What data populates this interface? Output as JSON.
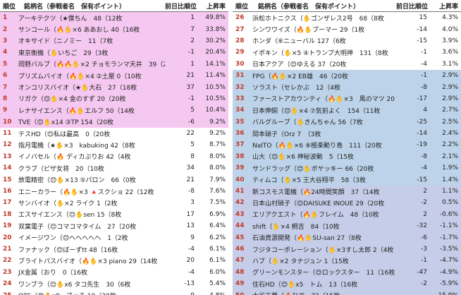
{
  "columns": {
    "rank": "順位",
    "name": "銘柄名（参戦者名　保有ポイント）",
    "diff": "前日比順位",
    "rate": "上昇率"
  },
  "colors": {
    "top_band": "#f4c8f0",
    "upper_right_band": "#bdd3e9",
    "lower_right_band": "#c6cde8",
    "rank_text": "#c0392b"
  },
  "left_rows": [
    {
      "rank": "1",
      "name": "アーキテクツ（★僕ちん　48（12枚",
      "diff": "1",
      "rate": "49.8%"
    },
    {
      "rank": "2",
      "name": "サンコール（🔥✋×6 ああおし 40（16枚",
      "diff": "7",
      "rate": "33.8%"
    },
    {
      "rank": "3",
      "name": "オキサイド（ニノミー　11（7枚",
      "diff": "2",
      "rate": "30.2%"
    },
    {
      "rank": "4",
      "name": "東京衡機（✋いちご　29（3枚",
      "diff": "-1",
      "rate": "20.4%"
    },
    {
      "rank": "5",
      "name": "岡野バルブ（🔥🔥✋×2 チョモランマ天井　39（2枚",
      "diff": "1",
      "rate": "14.1%"
    },
    {
      "rank": "6",
      "name": "プリズムバイオ（🔥✋×4 ②土屋 0（10枚",
      "diff": "21",
      "rate": "11.4%"
    },
    {
      "rank": "7",
      "name": "オンコリスバイオ（★✋大石　27（18枚",
      "diff": "37",
      "rate": "10.5%"
    },
    {
      "rank": "8",
      "name": "リガク（😊✋×4 金のすず 20（20枚",
      "diff": "-1",
      "rate": "10.5%"
    },
    {
      "rank": "9",
      "name": "レナサイエンス（🔥✋エルフ 50（14枚",
      "diff": "5",
      "rate": "10.4%"
    },
    {
      "rank": "10",
      "name": "TVE（😊✋x14 ③TP 154（20枚",
      "diff": "-6",
      "rate": "9.2%"
    },
    {
      "rank": "11",
      "name": "テスHD（😊私は最高　0（20枚",
      "diff": "22",
      "rate": "9.2%"
    },
    {
      "rank": "12",
      "name": "指月電機（★✋×3　kabuking 42（8枚",
      "diff": "5",
      "rate": "8.7%"
    },
    {
      "rank": "13",
      "name": "イノバセル（🔥 ディカぷりお 42（4枚",
      "diff": "8",
      "rate": "8.0%"
    },
    {
      "rank": "14",
      "name": "クラブ（ピザ女将　20（10枚",
      "diff": "34",
      "rate": "8.0%"
    },
    {
      "rank": "15",
      "name": "放電精密（😊✋×13 ⑤パロン　66（0枚",
      "diff": "21",
      "rate": "7.9%"
    },
    {
      "rank": "16",
      "name": "エニーカラー（🔥✋×3 🔺スクショ 22（12枚",
      "diff": "-8",
      "rate": "7.6%"
    },
    {
      "rank": "17",
      "name": "サンバイオ（✋×2 ライク 1（2枚",
      "diff": "3",
      "rate": "7.5%"
    },
    {
      "rank": "18",
      "name": "エスサイエンス（😊✋sen 15（8枚",
      "diff": "17",
      "rate": "6.9%"
    },
    {
      "rank": "19",
      "name": "双葉電子（😊コマコマタイム　27（20枚",
      "diff": "13",
      "rate": "6.4%"
    },
    {
      "rank": "20",
      "name": "イメージワン（😊へへへへへ　1（2枚",
      "diff": "9",
      "rate": "6.2%"
    },
    {
      "rank": "21",
      "name": "ファナック（😊ぼーずtt 48（16枚",
      "diff": "-4",
      "rate": "6.1%"
    },
    {
      "rank": "22",
      "name": "ブライトパスバイオ（🔥✋×3 piano 29（14枚",
      "diff": "20",
      "rate": "6.1%"
    },
    {
      "rank": "23",
      "name": "JX金属（おり　0（16枚",
      "diff": "-4",
      "rate": "6.0%"
    },
    {
      "rank": "24",
      "name": "ワンブラ（😊✋x6 タコ先生　30（6枚",
      "diff": "-13",
      "rate": "5.4%"
    },
    {
      "rank": "25",
      "name": "OTS（😊✋x9　ブッチ 10（20枚",
      "diff": "9",
      "rate": "4.8%"
    }
  ],
  "right_rows": [
    {
      "rank": "26",
      "name": "浜松ホトニクス（✋ゴンザレス2号　68（8枚",
      "diff": "15",
      "rate": "4.3%"
    },
    {
      "rank": "27",
      "name": "シンワワイズ（🔥✋ブーマー 29（1枚",
      "diff": "-14",
      "rate": "4.0%"
    },
    {
      "rank": "28",
      "name": "ホンダ（⑥ニューバル 127（6枚",
      "diff": "-15",
      "rate": "3.9%"
    },
    {
      "rank": "29",
      "name": "イポキン（✋×5 ④トランプ大明神　131（8枚",
      "diff": "-1",
      "rate": "3.6%"
    },
    {
      "rank": "30",
      "name": "日本アクア（😊ゆえる 37（20枚",
      "diff": "-4",
      "rate": "3.1%"
    },
    {
      "rank": "31",
      "name": "FPG（🔥✋×2 EB雄　46（20枚",
      "diff": "-1",
      "rate": "2.9%"
    },
    {
      "rank": "32",
      "name": "ソラスト（セレかぶ　12（4枚",
      "diff": "-8",
      "rate": "2.9%"
    },
    {
      "rank": "33",
      "name": "ファーストアカウンティ（🔥✋×3　風のマツ 20（0枚",
      "diff": "-17",
      "rate": "2.9%"
    },
    {
      "rank": "34",
      "name": "日本伸銅（😊✋×4 ⑦気前よく　154（11枚",
      "diff": "4",
      "rate": "2.7%"
    },
    {
      "rank": "35",
      "name": "バルグループ（✋きんちゃん 56（7枚",
      "diff": "-25",
      "rate": "2.5%"
    },
    {
      "rank": "36",
      "name": "岡本硝子（Orz 7　（3枚",
      "diff": "-14",
      "rate": "2.4%"
    },
    {
      "rank": "37",
      "name": "NaITO（🔥✋×6 ⑧極楽動り島　111（20枚",
      "diff": "-19",
      "rate": "2.2%"
    },
    {
      "rank": "38",
      "name": "山大（😊✋×6 神秘波動　5（15枚",
      "diff": "-8",
      "rate": "2.1%"
    },
    {
      "rank": "39",
      "name": "サンドラッグ（😊✋ボヤッキー 66（20枚",
      "diff": "-4",
      "rate": "1.9%"
    },
    {
      "rank": "40",
      "name": "ティムコ（✋×5 王大谷翔平　58（3枚",
      "diff": "-15",
      "rate": "1.4%"
    },
    {
      "rank": "41",
      "name": "新コスモス電機（🔥24時間笑顔　37（14枚",
      "diff": "2",
      "rate": "1.1%"
    },
    {
      "rank": "42",
      "name": "日本山村硝子（😊DAISUKE INOUE 29（20枚",
      "diff": "-2",
      "rate": "0.5%"
    },
    {
      "rank": "43",
      "name": "エリアクエスト（🔥✋フレイム　48（10枚",
      "diff": "2",
      "rate": "-0.6%"
    },
    {
      "rank": "44",
      "name": "shift（✋×4 桐吉　84（10枚",
      "diff": "-32",
      "rate": "-1.1%"
    },
    {
      "rank": "45",
      "name": "石油資源開発（🔥✋SU-san 27（8枚",
      "diff": "-6",
      "rate": "-1.7%"
    },
    {
      "rank": "46",
      "name": "フジタコーポレーション（✋×3すし太郎 2（4枚",
      "diff": "-3",
      "rate": "-3.5%"
    },
    {
      "rank": "47",
      "name": "ハブ（✋×2 タナジュン 1（15枚",
      "diff": "-1",
      "rate": "-4.7%"
    },
    {
      "rank": "48",
      "name": "グリーンモンスター（😊ロックスター　11（16枚",
      "diff": "-47",
      "rate": "-4.9%"
    },
    {
      "rank": "49",
      "name": "住石HD（😊✋x5　トム　13（16枚",
      "diff": "-2",
      "rate": "-5.9%"
    },
    {
      "rank": "50",
      "name": "大谷工業（🔥ひで　72（15枚",
      "diff": "",
      "rate": "-15.9%"
    }
  ]
}
